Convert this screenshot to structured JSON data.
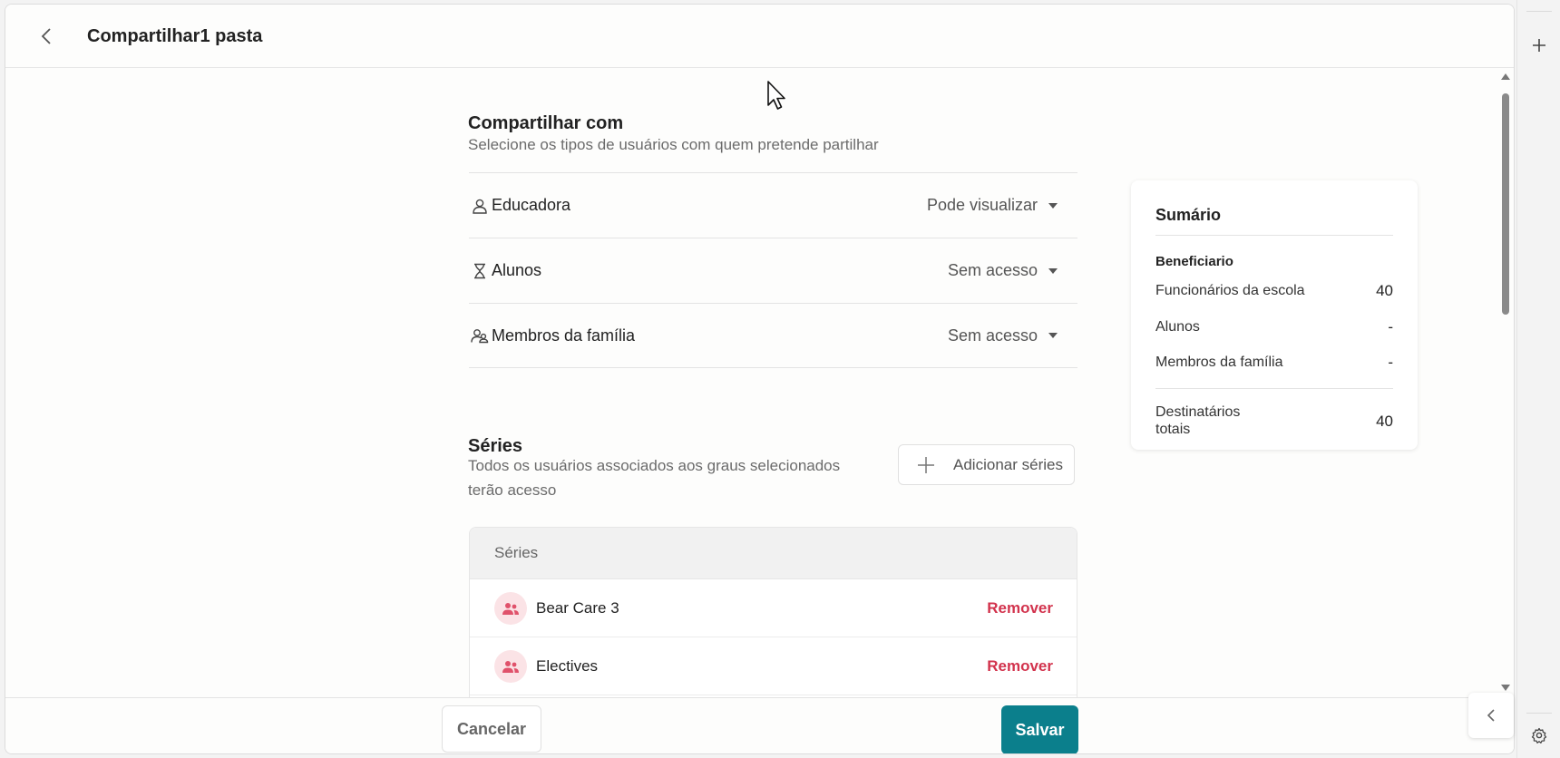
{
  "header": {
    "title": "Compartilhar1 pasta"
  },
  "share_with": {
    "title": "Compartilhar com",
    "subtitle": "Selecione os tipos de usuários com quem pretende partilhar",
    "rows": [
      {
        "label": "Educadora",
        "permission": "Pode visualizar",
        "icon": "person-icon"
      },
      {
        "label": "Alunos",
        "permission": "Sem acesso",
        "icon": "hourglass-icon"
      },
      {
        "label": "Membros da família",
        "permission": "Sem acesso",
        "icon": "family-icon"
      }
    ]
  },
  "series": {
    "title": "Séries",
    "subtitle": "Todos os usuários associados aos graus selecionados terão acesso",
    "add_button": "Adicionar séries",
    "table_header": "Séries",
    "items": [
      {
        "name": "Bear Care 3",
        "action": "Remover"
      },
      {
        "name": "Electives",
        "action": "Remover"
      }
    ]
  },
  "summary": {
    "title": "Sumário",
    "section": "Beneficiario",
    "rows": [
      {
        "label": "Funcionários da escola",
        "value": "40"
      },
      {
        "label": "Alunos",
        "value": "-"
      },
      {
        "label": "Membros da família",
        "value": "-"
      }
    ],
    "total_label": "Destinatários totais",
    "total_value": "40"
  },
  "footer": {
    "cancel": "Cancelar",
    "save": "Salvar"
  },
  "colors": {
    "primary": "#0b7f8c",
    "danger": "#d2334d",
    "avatar_bg": "#fbe3e6"
  }
}
